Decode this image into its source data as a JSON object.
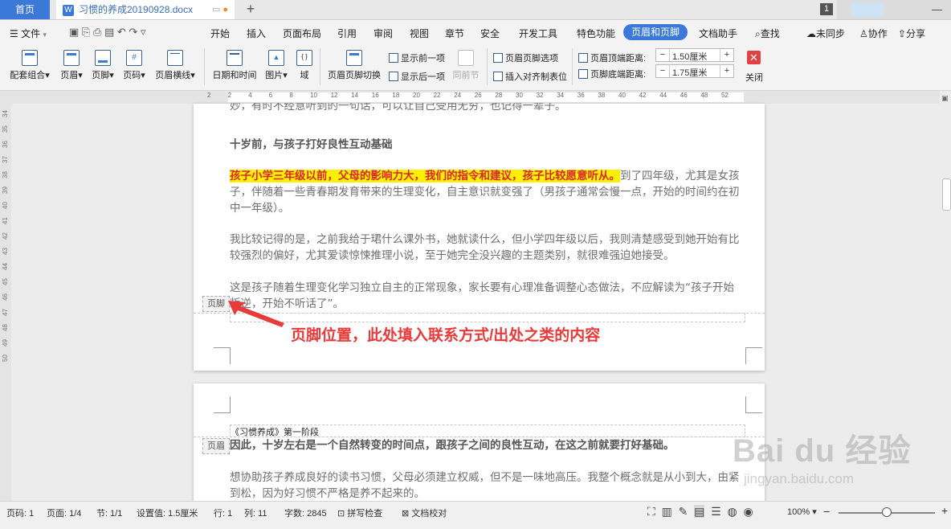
{
  "tabs": {
    "home": "首页",
    "document": "习惯的养成20190928.docx",
    "page_badge": "1"
  },
  "menu": {
    "file": "文件",
    "items": [
      "开始",
      "插入",
      "页面布局",
      "引用",
      "审阅",
      "视图",
      "章节",
      "安全",
      "开发工具",
      "特色功能"
    ],
    "active": "页眉和页脚",
    "doc_helper": "文档助手",
    "search": "查找",
    "sync": "未同步",
    "collab": "协作",
    "share": "分享"
  },
  "toolbar": {
    "combo": "配套组合",
    "header": "页眉",
    "footer": "页脚",
    "page_num": "页码",
    "header_line": "页眉横线",
    "date_time": "日期和时间",
    "picture": "图片",
    "field": "域",
    "switch": "页眉页脚切换",
    "show_prev": "显示前一项",
    "show_next": "显示后一项",
    "same_prev": "同前节",
    "options": "页眉页脚选项",
    "insert_tab": "插入对齐制表位",
    "header_top_label": "页眉顶端距离:",
    "header_top_value": "1.50厘米",
    "footer_bottom_label": "页脚底端距离:",
    "footer_bottom_value": "1.75厘米",
    "close": "关闭"
  },
  "ruler": {
    "marks": [
      "2",
      "2",
      "4",
      "6",
      "8",
      "10",
      "12",
      "14",
      "16",
      "18",
      "20",
      "22",
      "24",
      "26",
      "28",
      "30",
      "32",
      "34",
      "36",
      "38",
      "40",
      "42",
      "44",
      "46",
      "48",
      "52"
    ]
  },
  "vruler": [
    "34",
    "35",
    "36",
    "37",
    "38",
    "39",
    "40",
    "41",
    "42",
    "43",
    "44",
    "45",
    "46",
    "47",
    "48",
    "49",
    "50"
  ],
  "page1": {
    "cut_line": "妙，有时不经意听到的一句话，可以让自己受用无穷，也记得一辈子。",
    "heading": "十岁前，与孩子打好良性互动基础",
    "p1_highlight": "孩子小学三年级以前，父母的影响力大，我们的指令和建议，孩子比较愿意听从。",
    "p1_rest": "到了四年级，尤其是女孩子，伴随着一些青春期发育带来的生理变化，自主意识就变强了（男孩子通常会慢一点，开始的时间约在初中一年级）。",
    "p2": "我比较记得的是，之前我给于珺什么课外书，她就读什么，但小学四年级以后，我则清楚感受到她开始有比较强烈的偏好，尤其爱读惊悚推理小说，至于她完全没兴趣的主题类别，就很难强迫她接受。",
    "p3": "这是孩子随着生理变化学习独立自主的正常现象，家长要有心理准备调整心态做法，不应解读为“孩子开始叛逆，开始不听话了”。",
    "footer_tag": "页脚",
    "annotation": "页脚位置，此处填入联系方式/出处之类的内容"
  },
  "page2": {
    "header_text": "《习惯养成》第一阶段",
    "header_tag": "页眉",
    "p1": "因此，十岁左右是一个自然转变的时间点，跟孩子之间的良性互动，在这之前就要打好基础。",
    "p2": "想协助孩子养成良好的读书习惯，父母必须建立权威，但不是一味地高压。我整个概念就是从小到大，由紧到松，因为好习惯不严格是养不起来的。"
  },
  "status": {
    "page_num": "页码: 1",
    "page": "页面: 1/4",
    "section": "节: 1/1",
    "setting": "设置值: 1.5厘米",
    "row": "行: 1",
    "col": "列: 11",
    "words": "字数: 2845",
    "spell": "拼写检查",
    "proof": "文档校对",
    "zoom": "100%"
  },
  "watermark": {
    "brand": "Bai du 经验",
    "url": "jingyan.baidu.com"
  },
  "colors": {
    "accent": "#3b79d9",
    "highlight": "#ffef00",
    "annotation": "#e83a3a"
  }
}
